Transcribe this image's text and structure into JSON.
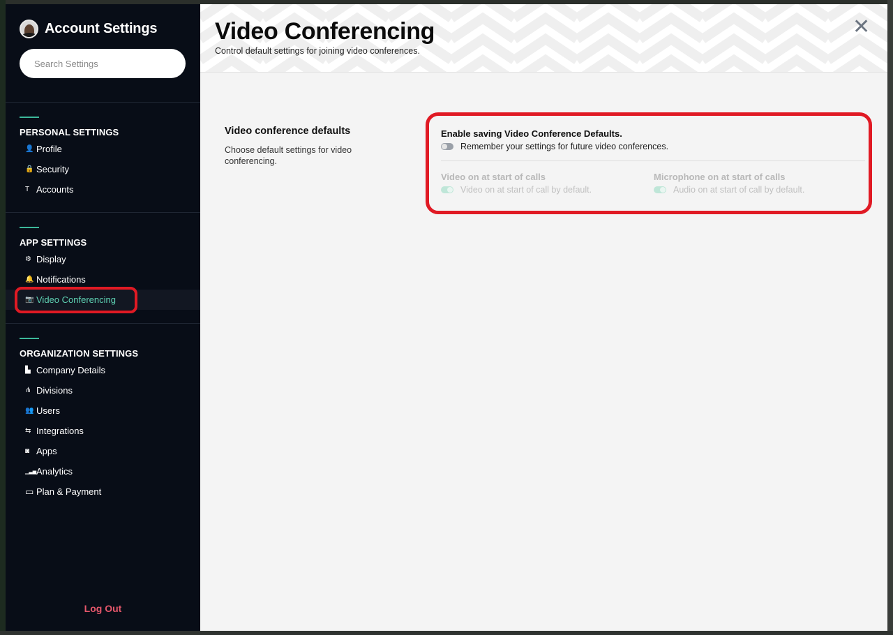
{
  "sidebar": {
    "title": "Account Settings",
    "search_placeholder": "Search Settings",
    "sections": [
      {
        "title": "PERSONAL SETTINGS",
        "items": [
          {
            "label": "Profile",
            "icon": "person-icon",
            "glyph": "👤"
          },
          {
            "label": "Security",
            "icon": "lock-icon",
            "glyph": "🔒"
          },
          {
            "label": "Accounts",
            "icon": "key-icon",
            "glyph": "T"
          }
        ]
      },
      {
        "title": "APP SETTINGS",
        "items": [
          {
            "label": "Display",
            "icon": "gear-icon",
            "glyph": "⚙"
          },
          {
            "label": "Notifications",
            "icon": "bell-icon",
            "glyph": "🔔"
          },
          {
            "label": "Video Conferencing",
            "icon": "camera-icon",
            "glyph": "📷",
            "active": true
          }
        ]
      },
      {
        "title": "ORGANIZATION SETTINGS",
        "items": [
          {
            "label": "Company Details",
            "icon": "building-icon",
            "glyph": "▙"
          },
          {
            "label": "Divisions",
            "icon": "hierarchy-icon",
            "glyph": "⋔"
          },
          {
            "label": "Users",
            "icon": "users-icon",
            "glyph": "👥"
          },
          {
            "label": "Integrations",
            "icon": "arrows-icon",
            "glyph": "⇆"
          },
          {
            "label": "Apps",
            "icon": "apps-icon",
            "glyph": "◙"
          },
          {
            "label": "Analytics",
            "icon": "bar-chart-icon",
            "glyph": "▁▃▅"
          },
          {
            "label": "Plan & Payment",
            "icon": "credit-card-icon",
            "glyph": "▭"
          }
        ]
      }
    ],
    "logout_label": "Log Out"
  },
  "main": {
    "title": "Video Conferencing",
    "subtitle": "Control default settings for joining video conferences.",
    "close_glyph": "✕",
    "section": {
      "heading": "Video conference defaults",
      "description": "Choose default settings for video conferencing."
    },
    "options": {
      "enable_title": "Enable saving Video Conference Defaults.",
      "enable_desc": "Remember your settings for future video conferences.",
      "enable_on": false,
      "video_title": "Video on at start of calls",
      "video_desc": "Video on at start of call by default.",
      "video_on": true,
      "mic_title": "Microphone on at start of calls",
      "mic_desc": "Audio on at start of call by default.",
      "mic_on": true
    }
  },
  "colors": {
    "accent": "#3cb89a",
    "active_text": "#5fd3b4",
    "logout": "#e6576b",
    "highlight": "#e01a24"
  }
}
